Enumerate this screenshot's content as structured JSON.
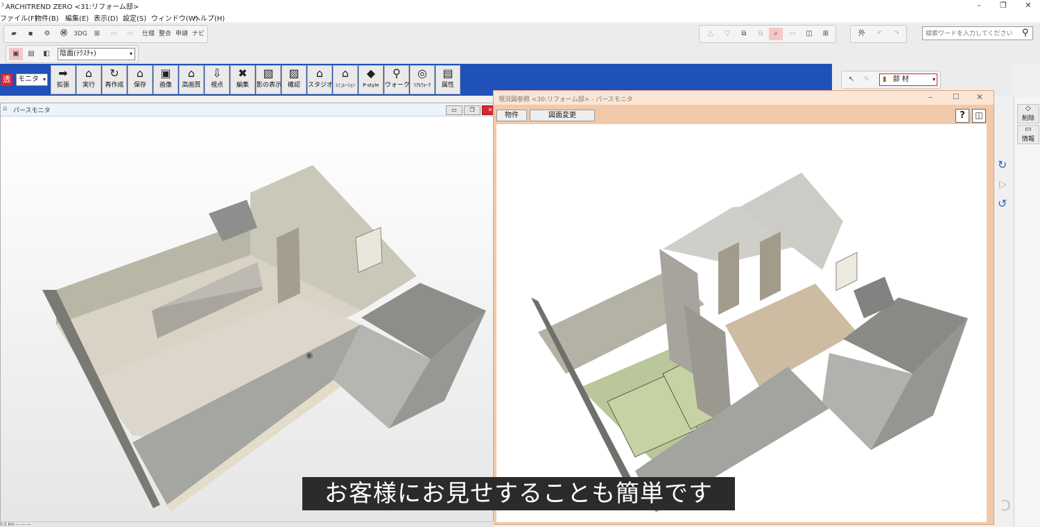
{
  "app": {
    "title": "ARCHITREND ZERO <31:リフォーム邸>"
  },
  "window_controls": {
    "minimize": "–",
    "restore": "❐",
    "close": "✕"
  },
  "menu": [
    "ファイル(F)",
    "物件(B)",
    "編集(E)",
    "表示(D)",
    "設定(S)",
    "ウィンドウ(W)",
    "ヘルプ(H)"
  ],
  "toolbar1": {
    "icons": [
      "open-icon",
      "save-icon",
      "settings-icon",
      "m-icon",
      "3dg-icon",
      "grid-icon",
      "copy-icon",
      "paste-icon"
    ],
    "labels": [
      "3DG",
      "仕様",
      "整合",
      "申請",
      "ナビ"
    ],
    "search_placeholder": "検索ワードを入力してください",
    "outside_label": "外"
  },
  "toolbar2": {
    "render_mode": "陰面(ﾃｸｽﾁｬ)",
    "transparent_label": "透",
    "monitor_label": "モニタ"
  },
  "ribbon": {
    "commands": [
      {
        "label": "拡張",
        "icon": "➡"
      },
      {
        "label": "実行",
        "icon": "⌂"
      },
      {
        "label": "再作成",
        "icon": "↻"
      },
      {
        "label": "保存",
        "icon": "⌂"
      },
      {
        "label": "画像",
        "icon": "▣"
      },
      {
        "label": "高画質",
        "icon": "⌂"
      },
      {
        "label": "視点",
        "icon": "⇩"
      },
      {
        "label": "編集",
        "icon": "✖"
      },
      {
        "label": "影の表示",
        "icon": "▧"
      },
      {
        "label": "確認",
        "icon": "▨"
      },
      {
        "label": "スタジオ",
        "icon": "⌂"
      },
      {
        "label": "ｼﾐｭﾚｰｼｮﾝ",
        "icon": "⌂"
      },
      {
        "label": "P-style",
        "icon": "◆"
      },
      {
        "label": "ウォーク",
        "icon": "⚲"
      },
      {
        "label": "ﾘｱﾙｳｫｰｸ",
        "icon": "◎"
      },
      {
        "label": "属性",
        "icon": "▤"
      }
    ],
    "part_label": "部 材"
  },
  "left_window": {
    "title": "パースモニタ",
    "controls": [
      "▭",
      "❐",
      "✕"
    ],
    "status": "0.5 km    —  —  —"
  },
  "right_window": {
    "title": "現況図参照 <30:リフォーム邸> - パースモニタ",
    "tabs": [
      "物件",
      "図面変更"
    ],
    "help": "?"
  },
  "side_panel": {
    "delete_label": "削除",
    "info_label": "情報"
  },
  "subtitle": "お客様にお見せすることも簡単です"
}
